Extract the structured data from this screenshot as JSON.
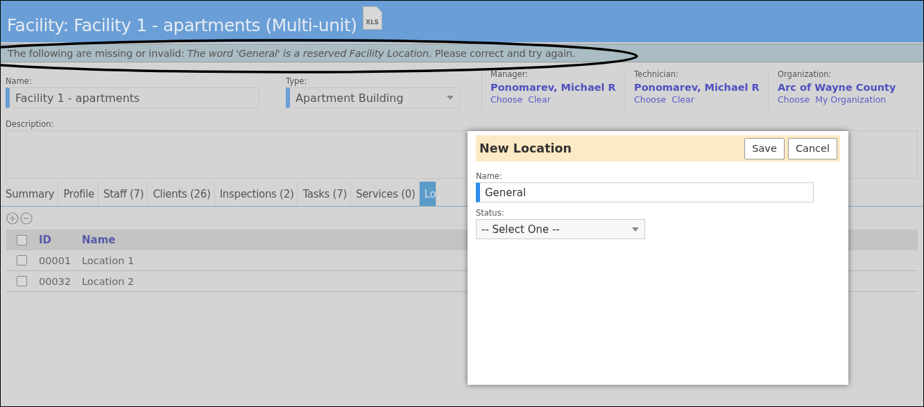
{
  "page": {
    "title": "Facility: Facility 1 - apartments (Multi-unit)",
    "export_label": "XLS"
  },
  "error_bar": {
    "text": "The following are missing or invalid: *The word 'General' is a reserved Facility Location*. Please correct and try again."
  },
  "form": {
    "name": {
      "label": "Name:",
      "value": "Facility 1 - apartments"
    },
    "type": {
      "label": "Type:",
      "value": "Apartment Building"
    },
    "people": [
      {
        "label": "Manager:",
        "value": "Ponomarev, Michael R",
        "links": [
          "Choose",
          "Clear"
        ]
      },
      {
        "label": "Technician:",
        "value": "Ponomarev, Michael R",
        "links": [
          "Choose",
          "Clear"
        ]
      },
      {
        "label": "Organization:",
        "value": "Arc of Wayne County",
        "links": [
          "Choose",
          "My Organization"
        ]
      }
    ],
    "description": {
      "label": "Description:"
    }
  },
  "tabs": [
    {
      "label": "Summary",
      "selected": false
    },
    {
      "label": "Profile",
      "selected": false
    },
    {
      "label": "Staff (7)",
      "selected": false
    },
    {
      "label": "Clients (26)",
      "selected": false
    },
    {
      "label": "Inspections (2)",
      "selected": false
    },
    {
      "label": "Tasks (7)",
      "selected": false
    },
    {
      "label": "Services (0)",
      "selected": false
    },
    {
      "label": "Lo",
      "selected": true
    }
  ],
  "table": {
    "all_checked": false,
    "columns": [
      "ID",
      "Name"
    ],
    "rows": [
      {
        "checked": false,
        "cells": [
          "00001",
          "Location 1"
        ]
      },
      {
        "checked": false,
        "cells": [
          "00032",
          "Location 2"
        ]
      }
    ]
  },
  "dialog": {
    "title": "New Location",
    "buttons": [
      "Save",
      "Cancel"
    ],
    "name": {
      "label": "Name:",
      "value": "General"
    },
    "status": {
      "label": "Status:",
      "value": "-- Select One --"
    }
  }
}
